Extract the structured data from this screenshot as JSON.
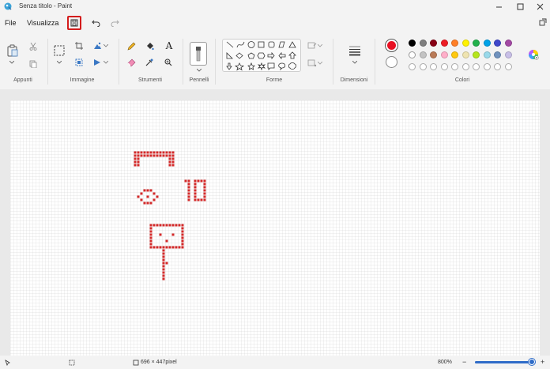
{
  "titlebar": {
    "title": "Senza titolo - Paint"
  },
  "menu": {
    "file": "File",
    "view": "Visualizza"
  },
  "ribbon": {
    "groups": {
      "clipboard": "Appunti",
      "image": "Immagine",
      "tools": "Strumenti",
      "brushes": "Pennelli",
      "shapes": "Forme",
      "size": "Dimensioni",
      "colors": "Colori"
    },
    "text_tool_glyph": "A",
    "color1": "#e81123",
    "color2": "#ffffff",
    "palette_row1": [
      "#000000",
      "#7f7f7f",
      "#880015",
      "#ed1c24",
      "#ff7f27",
      "#fff200",
      "#22b14c",
      "#00a2e8",
      "#3f48cc",
      "#a349a4"
    ],
    "palette_row2": [
      "#ffffff",
      "#c3c3c3",
      "#b97a57",
      "#ffaec9",
      "#ffc90e",
      "#efe4b0",
      "#b5e61d",
      "#99d9ea",
      "#7092be",
      "#c8bfe7"
    ]
  },
  "status": {
    "canvas_size": "696 × 447pixel",
    "zoom": "800%",
    "zoom_minus": "−",
    "zoom_plus": "+"
  },
  "drawing_color": "#d42a2a"
}
